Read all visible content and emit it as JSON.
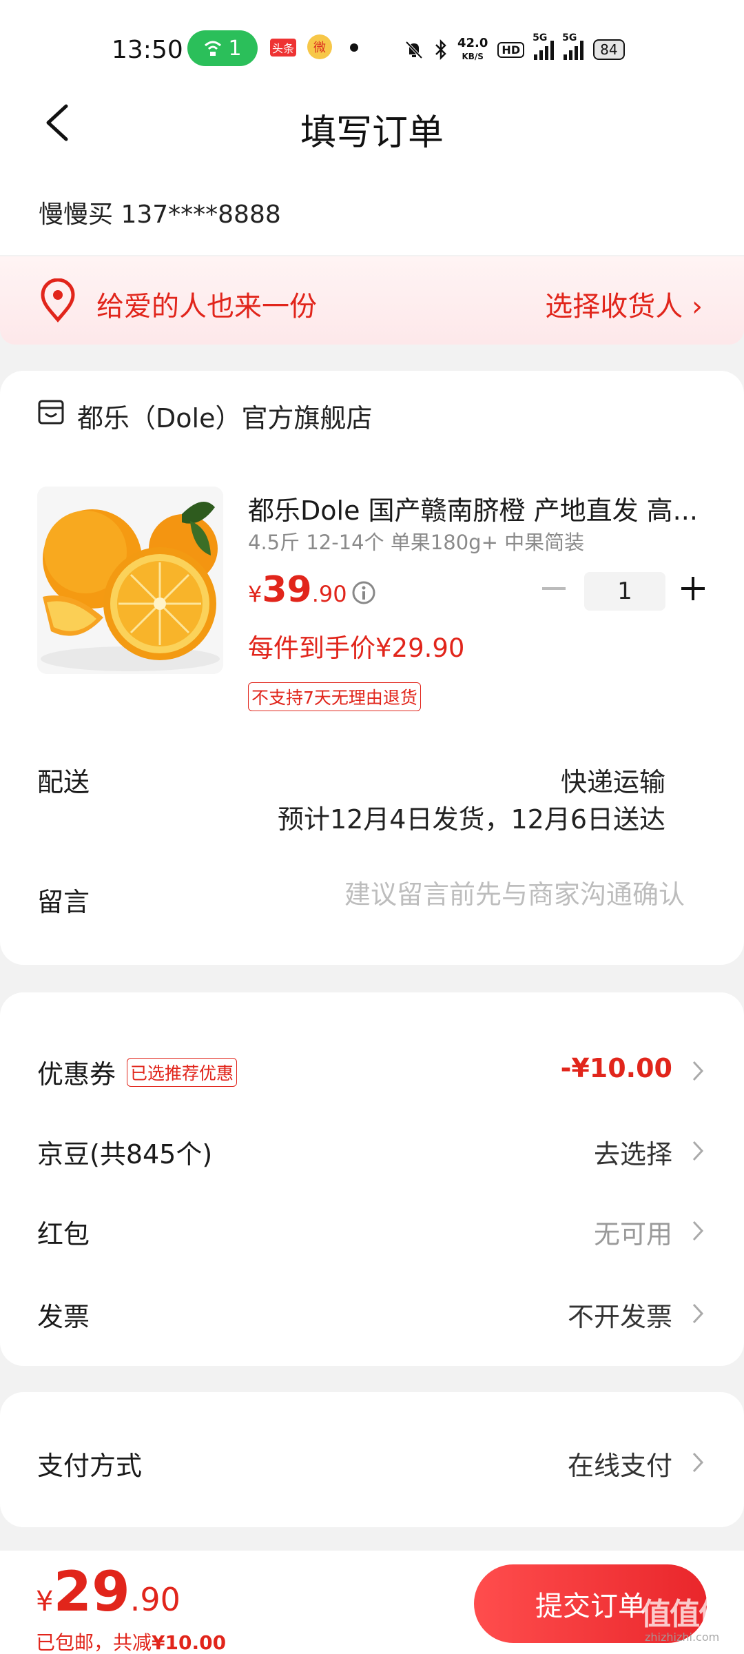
{
  "status_bar": {
    "time": "13:50",
    "wifi_badge": "1",
    "app1": "头条",
    "app2": "微",
    "speed_value": "42.0",
    "speed_unit": "KB/S",
    "hd_label": "HD",
    "net1": "5G",
    "net2": "5G",
    "battery": "84"
  },
  "header": {
    "title": "填写订单",
    "back_icon": "chevron-left-icon"
  },
  "contact": {
    "text": "慢慢买  137****8888"
  },
  "gift_banner": {
    "text": "给爱的人也来一份",
    "action": "选择收货人 ›",
    "icon": "location-pin-icon"
  },
  "shop": {
    "name": "都乐（Dole）官方旗舰店",
    "icon": "shop-icon"
  },
  "product": {
    "title": "都乐Dole 国产赣南脐橙 产地直发 高...",
    "spec": "4.5斤 12-14个 单果180g+ 中果简装",
    "price_currency": "¥",
    "price_int": "39",
    "price_dec": ".90",
    "unit_price": "每件到手价¥29.90",
    "return_tag": "不支持7天无理由退货",
    "quantity": "1"
  },
  "delivery": {
    "label": "配送",
    "method": "快递运输",
    "eta": "预计12月4日发货，12月6日送达"
  },
  "note": {
    "label": "留言",
    "placeholder": "建议留言前先与商家沟通确认"
  },
  "options": [
    {
      "label": "优惠券",
      "tag": "已选推荐优惠",
      "value": "-¥10.00"
    },
    {
      "label": "京豆(共845个)",
      "value": "去选择"
    },
    {
      "label": "红包",
      "value": "无可用"
    },
    {
      "label": "发票",
      "value": "不开发票"
    }
  ],
  "payment": {
    "label": "支付方式",
    "value": "在线支付"
  },
  "bottom": {
    "currency": "¥",
    "total_int": "29",
    "total_dec": ".90",
    "shipping": "已包邮，",
    "saved_prefix": "共减",
    "saved_amount": "¥10.00",
    "submit": "提交订单"
  },
  "watermark": {
    "main": "值值值",
    "sub": "zhizhizhi.com"
  },
  "colors": {
    "accent": "#e1251b",
    "wifi_green": "#2bbf5a",
    "background": "#f2f2f2"
  }
}
